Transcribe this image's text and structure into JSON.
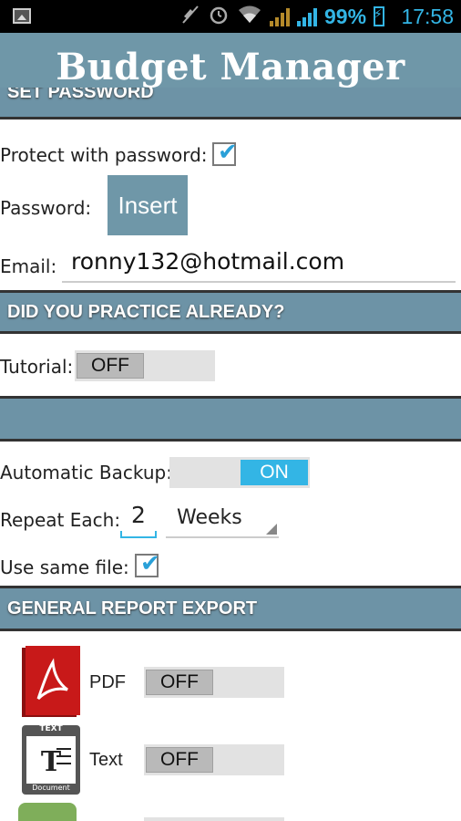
{
  "status_bar": {
    "battery": "99%",
    "time": "17:58",
    "icons": [
      "picture-icon",
      "mute-icon",
      "alarm-icon",
      "wifi-icon",
      "signal-icon",
      "battery-icon"
    ]
  },
  "app": {
    "title": "Budget Manager"
  },
  "sections": {
    "password": {
      "header": "SET PASSWORD",
      "protect_label": "Protect with password:",
      "protect_checked": true,
      "password_label": "Password:",
      "insert_button": "Insert",
      "email_label": "Email:",
      "email_value": "ronny132@hotmail.com"
    },
    "tutorial": {
      "header": "DID YOU PRACTICE ALREADY?",
      "label": "Tutorial:",
      "state": "OFF"
    },
    "backup": {
      "header": "",
      "auto_label": "Automatic Backup:",
      "auto_state": "ON",
      "repeat_label": "Repeat Each:",
      "repeat_value": "2",
      "repeat_unit": "Weeks",
      "same_file_label": "Use same file:",
      "same_file_checked": true
    },
    "export": {
      "header": "GENERAL REPORT EXPORT",
      "items": [
        {
          "label": "PDF",
          "state": "OFF",
          "icon": "pdf-document-icon"
        },
        {
          "label": "Text",
          "state": "OFF",
          "icon": "text-document-icon"
        }
      ],
      "icon_texts": {
        "text_top": "TEXT",
        "text_bottom": "Document"
      }
    }
  },
  "colors": {
    "header_bg": "#6d93a6",
    "accent": "#33b5e5",
    "toggle_off_knob": "#b9b9b9"
  }
}
